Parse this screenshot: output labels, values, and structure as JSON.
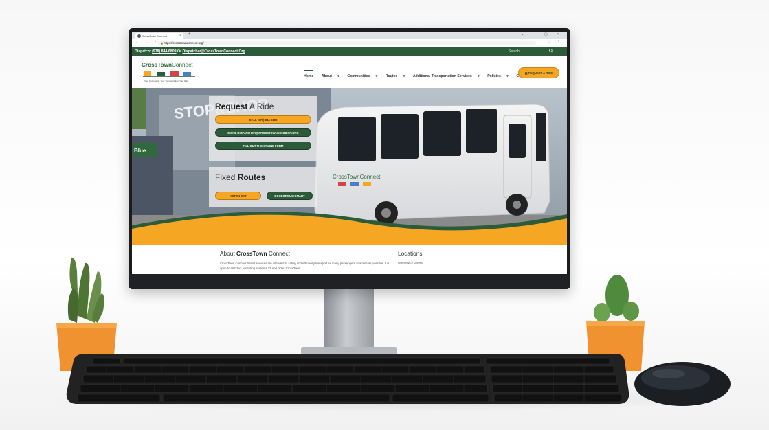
{
  "browser": {
    "tab_title": "CrossTown Connect",
    "url": "https://crosstownconnect.org/"
  },
  "topbar": {
    "dispatch_label": "Dispatch:",
    "phone": "(978) 844-6809",
    "or_text": "Or",
    "email": "Dispatcher@CrossTownConnect.Org",
    "search_placeholder": "Search ..."
  },
  "logo": {
    "brand_bold": "CrossTown",
    "brand_rest": "Connect",
    "tagline": "Your Community. Your Transportation. Your Way."
  },
  "nav": {
    "items": [
      "Home",
      "About",
      "Communities",
      "Routes",
      "Additional Transportation Services",
      "Policies",
      "Contact"
    ],
    "request_button": "REQUEST A RIDE"
  },
  "hero": {
    "store_sign": "STOP&SHOP",
    "bus_brand": "CrossTownConnect",
    "ride_panel": {
      "title_bold": "Request",
      "title_rest": "A Ride",
      "buttons": [
        "CALL (978) 844-6809",
        "EMAIL DISPATCHER@CROSSTOWNCONNECT.ORG",
        "FILL OUT THE ONLINE FORM"
      ]
    },
    "routes_panel": {
      "title_rest": "Fixed",
      "title_bold": "Routes",
      "buttons": [
        "ACTON CAT",
        "BOXBOROUGH MART"
      ]
    }
  },
  "about": {
    "title_rest": "About",
    "title_bold": "CrossTown",
    "title_end": "Connect",
    "text": "CrossTown Connect transit services are intended to safely and efficiently transport as many passengers at a time as possible. It is open to all riders, including students 12 and older. CrossTown"
  },
  "locations": {
    "title": "Locations",
    "text": "Our service covers:"
  },
  "colors": {
    "brand_green": "#2c5b3a",
    "brand_orange": "#f5a623"
  }
}
